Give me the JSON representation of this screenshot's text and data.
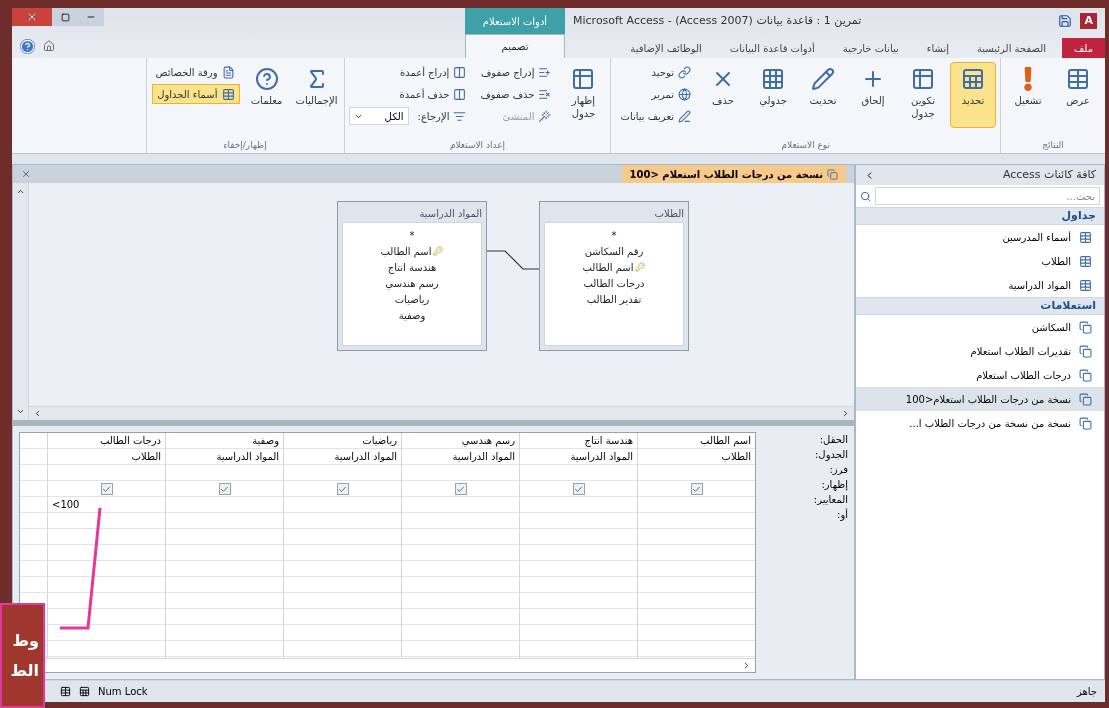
{
  "window": {
    "title": "Microsoft Access - (Access 2007) تمرين 1 : قاعدة بيانات",
    "app_logo": "A",
    "contextual_group": "أدوات الاستعلام"
  },
  "tabs": [
    {
      "label": "ملف",
      "kind": "file",
      "selected": false
    },
    {
      "label": "الصفحة الرئيسية",
      "kind": "tab",
      "selected": false
    },
    {
      "label": "إنشاء",
      "kind": "tab",
      "selected": false
    },
    {
      "label": "بيانات خارجية",
      "kind": "tab",
      "selected": false
    },
    {
      "label": "أدوات قاعدة البيانات",
      "kind": "tab",
      "selected": false
    },
    {
      "label": "الوظائف الإضافية",
      "kind": "tab",
      "selected": false
    }
  ],
  "contextual_tab": {
    "label": "تصميم",
    "selected": true
  },
  "ribbon": [
    {
      "title": "النتائج",
      "items": [
        {
          "label": "عرض",
          "kind": "large",
          "selected": false,
          "disabled": false
        },
        {
          "label": "تشغيل",
          "kind": "large",
          "selected": false,
          "disabled": false
        }
      ]
    },
    {
      "title": "نوع الاستعلام",
      "items": [
        {
          "label": "تحديد",
          "kind": "large",
          "selected": true,
          "disabled": false
        },
        {
          "label": "تكوين جدول",
          "kind": "large",
          "selected": false,
          "disabled": false
        },
        {
          "label": "إلحاق",
          "kind": "large",
          "selected": false,
          "disabled": false
        },
        {
          "label": "تحديث",
          "kind": "large",
          "selected": false,
          "disabled": false
        },
        {
          "label": "جدولي",
          "kind": "large",
          "selected": false,
          "disabled": false
        },
        {
          "label": "حذف",
          "kind": "large",
          "selected": false,
          "disabled": false
        },
        {
          "kind": "stack",
          "items": [
            {
              "label": "توحيد",
              "selected": false,
              "disabled": false
            },
            {
              "label": "تمرير",
              "selected": false,
              "disabled": false
            },
            {
              "label": "تعريف بيانات",
              "selected": false,
              "disabled": false
            }
          ]
        }
      ]
    },
    {
      "title": "إعداد الاستعلام",
      "items": [
        {
          "label": "إظهار جدول",
          "kind": "large",
          "selected": false,
          "disabled": false
        },
        {
          "kind": "stack",
          "items": [
            {
              "label": "إدراج صفوف",
              "selected": false,
              "disabled": false
            },
            {
              "label": "حذف صفوف",
              "selected": false,
              "disabled": false
            },
            {
              "label": "المنشئ",
              "selected": false,
              "disabled": true
            }
          ]
        },
        {
          "kind": "stack",
          "items": [
            {
              "label": "إدراج أعمدة",
              "selected": false,
              "disabled": false
            },
            {
              "label": "حذف أعمدة",
              "selected": false,
              "disabled": false
            },
            {
              "label": "الإرجاع:",
              "value": "الكل",
              "selected": false,
              "disabled": false
            }
          ]
        }
      ]
    },
    {
      "title": "إظهار/إخفاء",
      "items": [
        {
          "label": "الإجماليات",
          "kind": "large",
          "selected": false,
          "disabled": false
        },
        {
          "label": "معلمات",
          "kind": "large",
          "selected": false,
          "disabled": false
        },
        {
          "kind": "stack",
          "items": [
            {
              "label": "ورقة الخصائص",
              "selected": false,
              "disabled": false
            },
            {
              "label": "أسماء الجداول",
              "selected": true,
              "disabled": false
            }
          ]
        }
      ]
    }
  ],
  "document_tab": {
    "label": "نسخة من درجات الطلاب استعلام <100"
  },
  "field_lists": [
    {
      "title": "الطلاب",
      "fields": [
        {
          "name": "*",
          "key": false
        },
        {
          "name": "رقم السكاشن",
          "key": false
        },
        {
          "name": "اسم الطالب",
          "key": true
        },
        {
          "name": "درجات الطالب",
          "key": false
        },
        {
          "name": "تقدير الطالب",
          "key": false
        }
      ]
    },
    {
      "title": "المواد الدراسية",
      "fields": [
        {
          "name": "*",
          "key": false
        },
        {
          "name": "اسم الطالب",
          "key": true
        },
        {
          "name": "هندسة انتاج",
          "key": false
        },
        {
          "name": "رسم هندسي",
          "key": false
        },
        {
          "name": "رياضيات",
          "key": false
        },
        {
          "name": "وصفية",
          "key": false
        }
      ]
    }
  ],
  "grid": {
    "row_labels": [
      "الحقل:",
      "الجدول:",
      "فرز:",
      "إظهار:",
      "المعايير:",
      "أو:"
    ],
    "columns": [
      {
        "field": "اسم الطالب",
        "table": "الطلاب",
        "show": true
      },
      {
        "field": "هندسة انتاج",
        "table": "المواد الدراسية",
        "show": true
      },
      {
        "field": "رسم هندسي",
        "table": "المواد الدراسية",
        "show": true
      },
      {
        "field": "رياضيات",
        "table": "المواد الدراسية",
        "show": true
      },
      {
        "field": "وصفية",
        "table": "المواد الدراسية",
        "show": true
      },
      {
        "field": "درجات الطالب",
        "table": "الطلاب",
        "show": true,
        "criteria": "<100"
      }
    ]
  },
  "nav_pane": {
    "title": "كافة كائنات Access",
    "search_placeholder": "بحث...",
    "groups": [
      {
        "title": "جداول",
        "kind": "table",
        "items": [
          {
            "label": "أسماء المدرسين",
            "selected": false
          },
          {
            "label": "الطلاب",
            "selected": false
          },
          {
            "label": "المواد الدراسية",
            "selected": false
          }
        ]
      },
      {
        "title": "استعلامات",
        "kind": "query",
        "items": [
          {
            "label": "السكاشن",
            "selected": false
          },
          {
            "label": "تقديرات الطلاب استعلام",
            "selected": false
          },
          {
            "label": "درجات الطلاب استعلام",
            "selected": false
          },
          {
            "label": "نسخة من درجات الطلاب استعلام<100",
            "selected": true
          },
          {
            "label": "نسخة من نسخة من درجات الطلاب ا...",
            "selected": false
          }
        ]
      }
    ]
  },
  "status_bar": {
    "text": "جاهز",
    "indicator": "Num Lock"
  },
  "callout": {
    "lines": [
      "وط",
      "الط"
    ]
  }
}
